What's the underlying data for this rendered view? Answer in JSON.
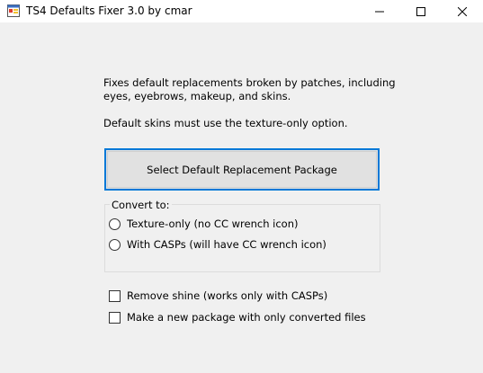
{
  "window": {
    "title": "TS4 Defaults Fixer 3.0 by cmar",
    "icon": "app-window-icon",
    "controls": [
      "minimize-icon",
      "maximize-icon",
      "close-icon"
    ]
  },
  "description": {
    "line1": "Fixes default replacements broken by patches, including",
    "line2": "eyes, eyebrows, makeup, and skins.",
    "note": "Default skins must use the texture-only option."
  },
  "select_button": {
    "label": "Select Default Replacement Package"
  },
  "convert_group": {
    "label": "Convert to:",
    "options": [
      {
        "label": "Texture-only (no CC wrench icon)",
        "selected": false
      },
      {
        "label": "With CASPs (will have CC wrench icon)",
        "selected": false
      }
    ]
  },
  "checkboxes": [
    {
      "label": "Remove shine (works only with CASPs)",
      "checked": false
    },
    {
      "label": "Make a new package with only converted files",
      "checked": false
    }
  ],
  "colors": {
    "accent": "#0078d7",
    "background": "#f0f0f0",
    "titlebar": "#ffffff"
  }
}
